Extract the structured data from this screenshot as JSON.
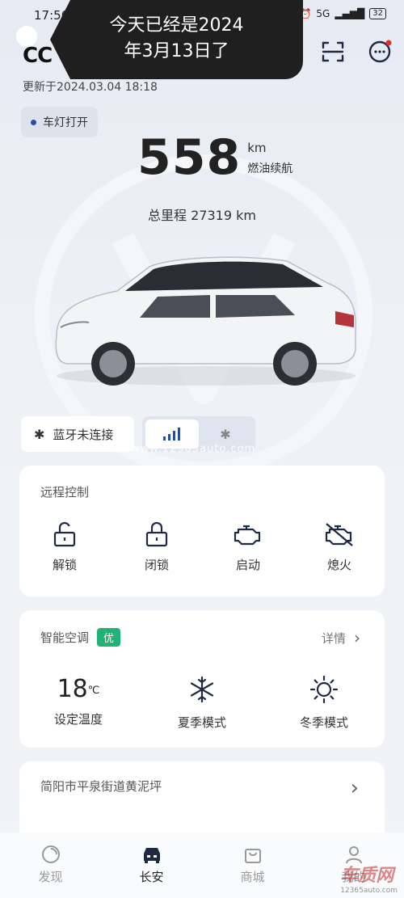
{
  "status_bar": {
    "time": "17:56",
    "network": "5G",
    "battery": "32"
  },
  "toast": {
    "line1": "今天已经是2024",
    "line2": "年3月13日了"
  },
  "header": {
    "logo": "CC",
    "updated": "更新于2024.03.04 18:18"
  },
  "vehicle": {
    "lamp_status": "车灯打开",
    "range_value": "558",
    "range_unit": "km",
    "range_label": "燃油续航",
    "odometer": "总里程 27319 km"
  },
  "connection": {
    "bluetooth_status": "蓝牙未连接",
    "watermark": "www.12365auto.com"
  },
  "remote_control": {
    "title": "远程控制",
    "items": [
      {
        "label": "解锁",
        "icon": "unlock-icon"
      },
      {
        "label": "闭锁",
        "icon": "lock-icon"
      },
      {
        "label": "启动",
        "icon": "engine-start-icon"
      },
      {
        "label": "熄火",
        "icon": "engine-off-icon"
      }
    ]
  },
  "climate": {
    "title": "智能空调",
    "badge": "优",
    "detail": "详情",
    "temperature": "18",
    "temperature_unit": "℃",
    "items": [
      {
        "label": "设定温度"
      },
      {
        "label": "夏季模式",
        "icon": "snowflake-icon"
      },
      {
        "label": "冬季模式",
        "icon": "sun-icon"
      }
    ]
  },
  "location": {
    "text": "简阳市平泉街道黄泥坪"
  },
  "bottom_nav": [
    {
      "label": "发现",
      "icon": "discover-icon"
    },
    {
      "label": "长安",
      "icon": "car-icon",
      "active": true
    },
    {
      "label": "商城",
      "icon": "shop-bag-icon"
    },
    {
      "label": "我的",
      "icon": "profile-icon"
    }
  ],
  "corner_watermark": {
    "brand": "车质网",
    "url": "12365auto.com"
  },
  "colors": {
    "accent_green": "#22b276",
    "primary_blue": "#2a4d9a",
    "icon_dark": "#1e2a44"
  }
}
